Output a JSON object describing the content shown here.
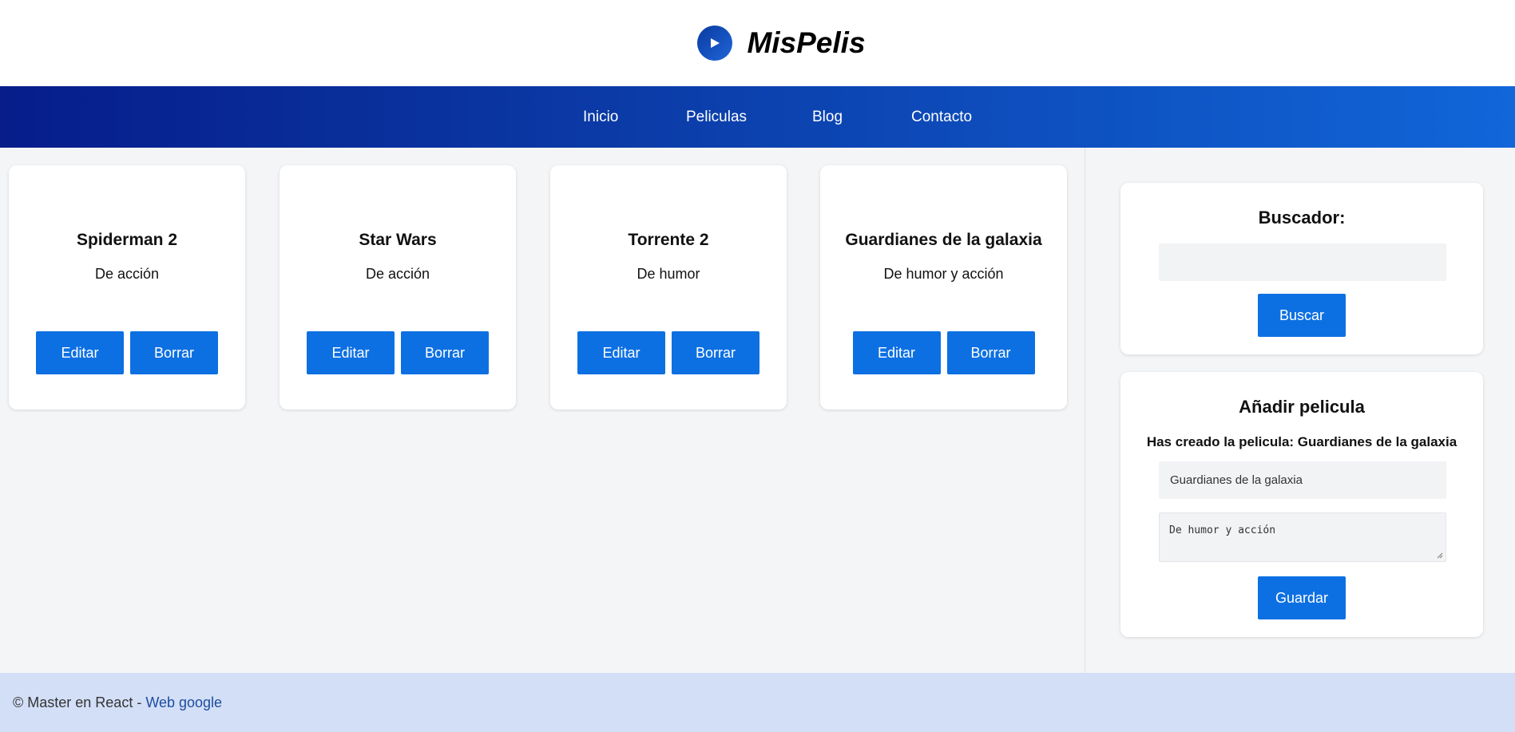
{
  "header": {
    "title": "MisPelis",
    "logo_icon": "play-icon"
  },
  "nav": {
    "items": [
      {
        "label": "Inicio"
      },
      {
        "label": "Peliculas"
      },
      {
        "label": "Blog"
      },
      {
        "label": "Contacto"
      }
    ]
  },
  "movies": [
    {
      "title": "Spiderman 2",
      "description": "De acción",
      "edit_label": "Editar",
      "delete_label": "Borrar"
    },
    {
      "title": "Star Wars",
      "description": "De acción",
      "edit_label": "Editar",
      "delete_label": "Borrar"
    },
    {
      "title": "Torrente 2",
      "description": "De humor",
      "edit_label": "Editar",
      "delete_label": "Borrar"
    },
    {
      "title": "Guardianes de la galaxia",
      "description": "De humor y acción",
      "edit_label": "Editar",
      "delete_label": "Borrar"
    }
  ],
  "search": {
    "title": "Buscador:",
    "value": "",
    "button_label": "Buscar"
  },
  "add_movie": {
    "title": "Añadir pelicula",
    "message": "Has creado la pelicula: Guardianes de la galaxia",
    "title_value": "Guardianes de la galaxia",
    "description_value": "De humor y acción",
    "save_label": "Guardar"
  },
  "footer": {
    "text": "© Master en React - ",
    "link_label": "Web google"
  },
  "colors": {
    "accent": "#0d70e2",
    "nav_start": "#061d8a",
    "nav_end": "#1166d9",
    "footer_bg": "#d3dff7"
  }
}
